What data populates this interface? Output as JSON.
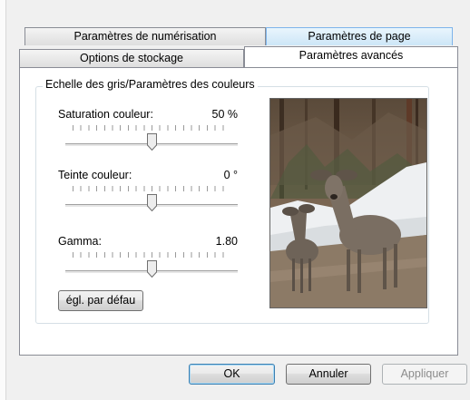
{
  "tabs": {
    "row_back": [
      {
        "label": "Paramètres de numérisation"
      },
      {
        "label": "Paramètres de page"
      }
    ],
    "row_front": [
      {
        "label": "Options de stockage"
      },
      {
        "label": "Paramètres avancés"
      }
    ],
    "selected": "Paramètres avancés",
    "hover": "Paramètres de page"
  },
  "group": {
    "title": "Echelle des gris/Paramètres des couleurs",
    "sliders": [
      {
        "label": "Saturation couleur:",
        "value": "50 %",
        "position": 0.5
      },
      {
        "label": "Teinte couleur:",
        "value": "0 °",
        "position": 0.5
      },
      {
        "label": "Gamma:",
        "value": "1.80",
        "position": 0.5
      }
    ],
    "reset_label": "égl. par défau"
  },
  "preview": {
    "icon": "deer-photo"
  },
  "footer": {
    "ok_label": "OK",
    "cancel_label": "Annuler",
    "apply_label": "Appliquer"
  },
  "colors": {
    "tab_hover": "#cde6f7",
    "default_button_border": "#3c7fb1"
  }
}
